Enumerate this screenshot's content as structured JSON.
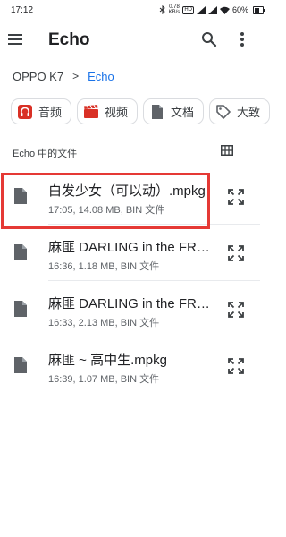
{
  "status_bar": {
    "time": "17:12",
    "net_speed_value": "0.78",
    "net_speed_unit": "KB/s",
    "hd_badge": "HD",
    "battery": "60%"
  },
  "app_bar": {
    "title": "Echo"
  },
  "breadcrumb": {
    "root": "OPPO K7",
    "separator": ">",
    "current": "Echo"
  },
  "chips": [
    {
      "label": "音频",
      "icon": "headphones-icon",
      "color": "#d93025"
    },
    {
      "label": "视频",
      "icon": "clapperboard-icon",
      "color": "#d93025"
    },
    {
      "label": "文档",
      "icon": "document-icon",
      "color": "#5f6368"
    },
    {
      "label": "大致",
      "icon": "tag-icon",
      "color": "#5f6368"
    }
  ],
  "section": {
    "header": "Echo 中的文件"
  },
  "files": [
    {
      "name": "白发少女（可以动）.mpkg",
      "meta": "17:05, 14.08 MB, BIN 文件"
    },
    {
      "name": "麻匪 DARLING in the FRANXX.mpkg",
      "meta": "16:36, 1.18 MB, BIN 文件"
    },
    {
      "name": "麻匪 DARLING in the FRANXX.mpkg",
      "meta": "16:33, 2.13 MB, BIN 文件"
    },
    {
      "name": "麻匪 ~ 高中生.mpkg",
      "meta": "16:39, 1.07 MB, BIN 文件"
    }
  ],
  "colors": {
    "accent": "#1a73e8",
    "highlight": "#e53935"
  }
}
